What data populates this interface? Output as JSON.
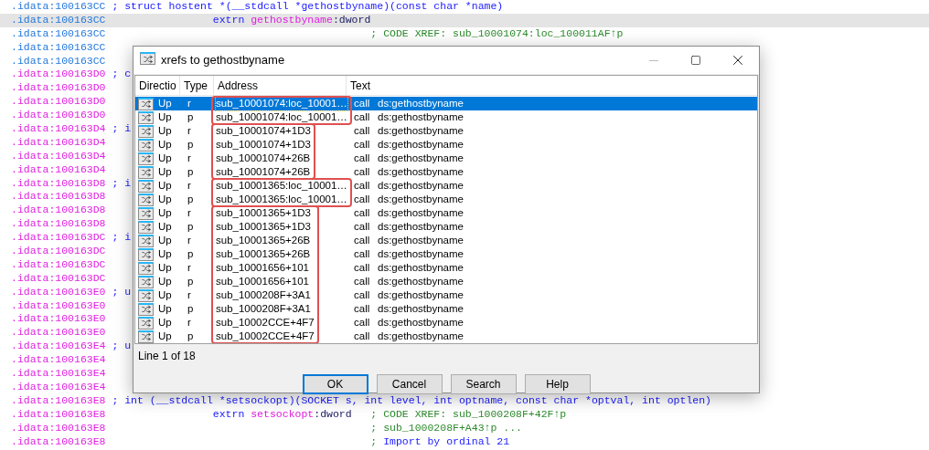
{
  "listing": [
    {
      "address": ".idata:100163CC",
      "color": "#2277dd",
      "highlighted": false,
      "declaration": "; struct hostent *(__stdcall *gethostbyname)(const char *name)"
    },
    {
      "address": ".idata:100163CC",
      "color": "#2277dd",
      "highlighted": true,
      "instruction": {
        "keyword": "extrn",
        "name": "gethostbyname",
        "suffix": ":dword"
      }
    },
    {
      "address": ".idata:100163CC",
      "color": "#2277dd",
      "highlighted": false,
      "comment": {
        "kind": "xref",
        "marker": ";",
        "text": "CODE XREF: sub_10001074:loc_100011AF↑p"
      }
    },
    {
      "address": ".idata:100163CC",
      "color": "#2277dd",
      "highlighted": false
    },
    {
      "address": ".idata:100163CC",
      "color": "#2277dd",
      "highlighted": false
    },
    {
      "address": ".idata:100163D0",
      "color": "#e020e0",
      "highlighted": false,
      "declaration": "; c"
    },
    {
      "address": ".idata:100163D0",
      "color": "#e020e0",
      "highlighted": false
    },
    {
      "address": ".idata:100163D0",
      "color": "#e020e0",
      "highlighted": false
    },
    {
      "address": ".idata:100163D0",
      "color": "#e020e0",
      "highlighted": false
    },
    {
      "address": ".idata:100163D4",
      "color": "#e020e0",
      "highlighted": false,
      "declaration": "; i"
    },
    {
      "address": ".idata:100163D4",
      "color": "#e020e0",
      "highlighted": false
    },
    {
      "address": ".idata:100163D4",
      "color": "#e020e0",
      "highlighted": false
    },
    {
      "address": ".idata:100163D4",
      "color": "#e020e0",
      "highlighted": false
    },
    {
      "address": ".idata:100163D8",
      "color": "#e020e0",
      "highlighted": false,
      "declaration": "; i"
    },
    {
      "address": ".idata:100163D8",
      "color": "#e020e0",
      "highlighted": false
    },
    {
      "address": ".idata:100163D8",
      "color": "#e020e0",
      "highlighted": false
    },
    {
      "address": ".idata:100163D8",
      "color": "#e020e0",
      "highlighted": false
    },
    {
      "address": ".idata:100163DC",
      "color": "#e020e0",
      "highlighted": false,
      "declaration": "; i"
    },
    {
      "address": ".idata:100163DC",
      "color": "#e020e0",
      "highlighted": false
    },
    {
      "address": ".idata:100163DC",
      "color": "#e020e0",
      "highlighted": false
    },
    {
      "address": ".idata:100163DC",
      "color": "#e020e0",
      "highlighted": false
    },
    {
      "address": ".idata:100163E0",
      "color": "#e020e0",
      "highlighted": false,
      "declaration": "; u"
    },
    {
      "address": ".idata:100163E0",
      "color": "#e020e0",
      "highlighted": false
    },
    {
      "address": ".idata:100163E0",
      "color": "#e020e0",
      "highlighted": false
    },
    {
      "address": ".idata:100163E0",
      "color": "#e020e0",
      "highlighted": false
    },
    {
      "address": ".idata:100163E4",
      "color": "#e020e0",
      "highlighted": false,
      "declaration": "; u"
    },
    {
      "address": ".idata:100163E4",
      "color": "#e020e0",
      "highlighted": false
    },
    {
      "address": ".idata:100163E4",
      "color": "#e020e0",
      "highlighted": false
    },
    {
      "address": ".idata:100163E4",
      "color": "#e020e0",
      "highlighted": false
    },
    {
      "address": ".idata:100163E8",
      "color": "#e020e0",
      "highlighted": false,
      "declaration": "; int (__stdcall *setsockopt)(SOCKET s, int level, int optname, const char *optval, int optlen)"
    },
    {
      "address": ".idata:100163E8",
      "color": "#e020e0",
      "highlighted": false,
      "instruction": {
        "keyword": "extrn",
        "name": "setsockopt",
        "suffix": ":dword"
      },
      "comment": {
        "kind": "xref",
        "marker": ";",
        "text": "CODE XREF: sub_1000208F+42F↑p"
      }
    },
    {
      "address": ".idata:100163E8",
      "color": "#e020e0",
      "highlighted": false,
      "comment": {
        "kind": "xref",
        "marker": ";",
        "text": "sub_1000208F+A43↑p ..."
      }
    },
    {
      "address": ".idata:100163E8",
      "color": "#e020e0",
      "highlighted": false,
      "comment": {
        "kind": "import",
        "marker": ";",
        "text": "Import by ordinal 21"
      }
    }
  ],
  "dialog": {
    "title": "xrefs to gethostbyname",
    "table": {
      "columns": [
        "Directio",
        "Type",
        "Address",
        "Text"
      ],
      "groups": [
        {
          "rows": [
            {
              "direction": "Up",
              "type": "r",
              "address": "sub_10001074:loc_10001…",
              "op": "call",
              "target": "ds:gethostbyname",
              "selected": true
            },
            {
              "direction": "Up",
              "type": "p",
              "address": "sub_10001074:loc_10001…",
              "op": "call",
              "target": "ds:gethostbyname",
              "selected": false
            }
          ]
        },
        {
          "rows": [
            {
              "direction": "Up",
              "type": "r",
              "address": "sub_10001074+1D3",
              "op": "call",
              "target": "ds:gethostbyname",
              "selected": false
            },
            {
              "direction": "Up",
              "type": "p",
              "address": "sub_10001074+1D3",
              "op": "call",
              "target": "ds:gethostbyname",
              "selected": false
            },
            {
              "direction": "Up",
              "type": "r",
              "address": "sub_10001074+26B",
              "op": "call",
              "target": "ds:gethostbyname",
              "selected": false
            },
            {
              "direction": "Up",
              "type": "p",
              "address": "sub_10001074+26B",
              "op": "call",
              "target": "ds:gethostbyname",
              "selected": false
            }
          ]
        },
        {
          "rows": [
            {
              "direction": "Up",
              "type": "r",
              "address": "sub_10001365:loc_10001…",
              "op": "call",
              "target": "ds:gethostbyname",
              "selected": false
            },
            {
              "direction": "Up",
              "type": "p",
              "address": "sub_10001365:loc_10001…",
              "op": "call",
              "target": "ds:gethostbyname",
              "selected": false
            }
          ]
        },
        {
          "rows": [
            {
              "direction": "Up",
              "type": "r",
              "address": "sub_10001365+1D3",
              "op": "call",
              "target": "ds:gethostbyname",
              "selected": false
            },
            {
              "direction": "Up",
              "type": "p",
              "address": "sub_10001365+1D3",
              "op": "call",
              "target": "ds:gethostbyname",
              "selected": false
            },
            {
              "direction": "Up",
              "type": "r",
              "address": "sub_10001365+26B",
              "op": "call",
              "target": "ds:gethostbyname",
              "selected": false
            },
            {
              "direction": "Up",
              "type": "p",
              "address": "sub_10001365+26B",
              "op": "call",
              "target": "ds:gethostbyname",
              "selected": false
            },
            {
              "direction": "Up",
              "type": "r",
              "address": "sub_10001656+101",
              "op": "call",
              "target": "ds:gethostbyname",
              "selected": false
            },
            {
              "direction": "Up",
              "type": "p",
              "address": "sub_10001656+101",
              "op": "call",
              "target": "ds:gethostbyname",
              "selected": false
            },
            {
              "direction": "Up",
              "type": "r",
              "address": "sub_1000208F+3A1",
              "op": "call",
              "target": "ds:gethostbyname",
              "selected": false
            },
            {
              "direction": "Up",
              "type": "p",
              "address": "sub_1000208F+3A1",
              "op": "call",
              "target": "ds:gethostbyname",
              "selected": false
            },
            {
              "direction": "Up",
              "type": "r",
              "address": "sub_10002CCE+4F7",
              "op": "call",
              "target": "ds:gethostbyname",
              "selected": false
            },
            {
              "direction": "Up",
              "type": "p",
              "address": "sub_10002CCE+4F7",
              "op": "call",
              "target": "ds:gethostbyname",
              "selected": false
            }
          ]
        }
      ]
    },
    "status": "Line 1 of 18",
    "buttons": [
      {
        "label": "OK",
        "default": true
      },
      {
        "label": "Cancel",
        "default": false
      },
      {
        "label": "Search",
        "default": false
      },
      {
        "label": "Help",
        "default": false
      }
    ]
  }
}
